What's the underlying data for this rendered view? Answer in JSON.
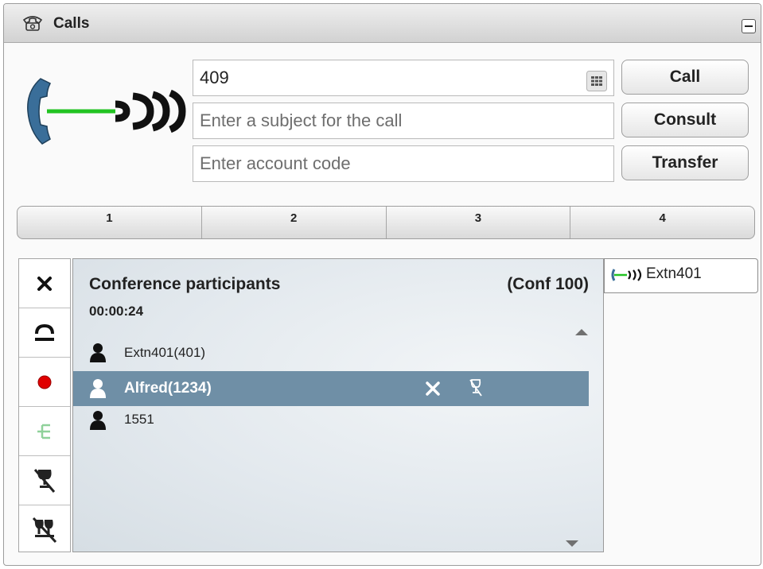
{
  "window": {
    "title": "Calls",
    "title_icon": "telephone-icon",
    "collapse_icon": "minimize-icon"
  },
  "dial": {
    "number_value": "409",
    "subject_placeholder": "Enter a subject for the call",
    "account_placeholder": "Enter account code",
    "keypad_icon": "keypad-grid-icon"
  },
  "buttons": {
    "call": "Call",
    "consult": "Consult",
    "transfer": "Transfer"
  },
  "tabs": [
    {
      "label": "1"
    },
    {
      "label": "2"
    },
    {
      "label": "3"
    },
    {
      "label": "4"
    }
  ],
  "side_tools": [
    {
      "icon": "drop-call-icon"
    },
    {
      "icon": "hold-icon"
    },
    {
      "icon": "record-icon"
    },
    {
      "icon": "conference-tree-icon",
      "enabled": false
    },
    {
      "icon": "mute-icon"
    },
    {
      "icon": "mute-all-icon"
    }
  ],
  "conference": {
    "title": "Conference participants",
    "conf_id": "(Conf 100)",
    "timer": "00:00:24",
    "participants": [
      {
        "name": "Extn401(401)",
        "selected": false
      },
      {
        "name": "Alfred(1234)",
        "selected": true,
        "actions": [
          "remove-participant-icon",
          "mute-participant-icon"
        ]
      },
      {
        "name": "1551",
        "selected": false
      }
    ]
  },
  "connected_call": {
    "label": "Extn401",
    "icon": "connected-call-icon"
  },
  "colors": {
    "selected_row": "#6f8fa6",
    "line_green": "#22c322",
    "handset_blue": "#3a6e99",
    "record_red": "#e00000"
  }
}
